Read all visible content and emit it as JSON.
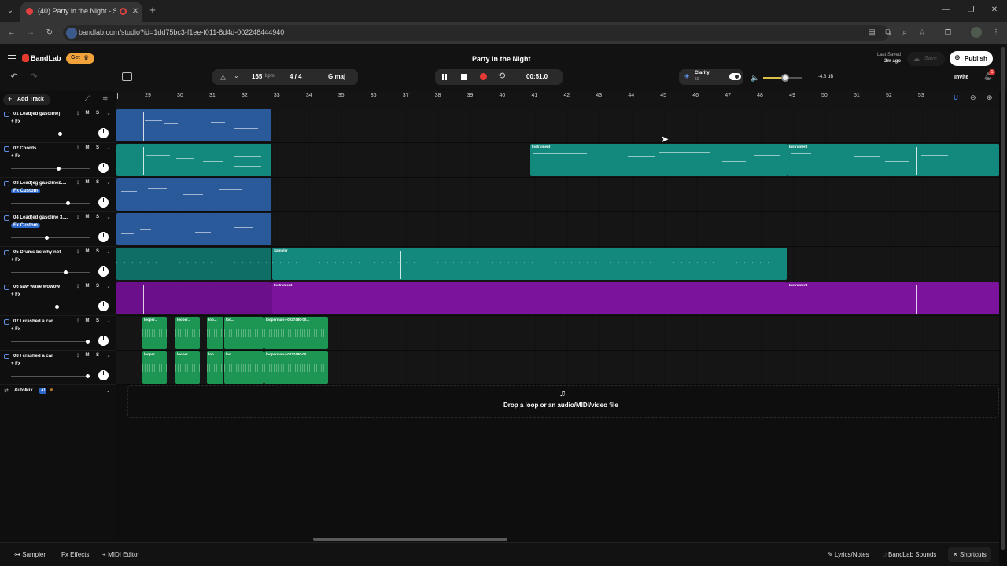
{
  "browser": {
    "tab_title": "(40) Party in the Night - Stu",
    "url": "bandlab.com/studio?id=1dd75bc3-f1ee-f011-8d4d-002248444940"
  },
  "header": {
    "brand": "BandLab",
    "get_label": "Get",
    "project_title": "Party in the Night",
    "last_saved_label": "Last Saved",
    "last_saved_time": "2m ago",
    "save_label": "Save",
    "publish_label": "Publish",
    "invite_label": "Invite",
    "notification_count": "1"
  },
  "transport": {
    "bpm_value": "165",
    "bpm_unit": "bpm",
    "time_signature": "4 / 4",
    "key": "G maj",
    "time": "00:51.0"
  },
  "master": {
    "clarity_label": "Clarity",
    "clarity_value": "50",
    "volume_db": "-4.8 dB",
    "volume_level": 0.55
  },
  "toolbar": {
    "add_track_label": "Add Track"
  },
  "ruler": {
    "bars": [
      "29",
      "30",
      "31",
      "32",
      "33",
      "34",
      "35",
      "36",
      "37",
      "38",
      "39",
      "40",
      "41",
      "42",
      "43",
      "44",
      "45",
      "46",
      "47",
      "48",
      "49",
      "50",
      "51",
      "52",
      "53"
    ]
  },
  "tracks": [
    {
      "name": "01  Lead(ed gasoline)",
      "fx": "+ Fx",
      "fx_custom": false,
      "volume": 0.62
    },
    {
      "name": "02  Chords",
      "fx": "+ Fx",
      "fx_custom": false,
      "volume": 0.6
    },
    {
      "name": "03  Lead(eg gasoline2....",
      "fx": "Fx Custom",
      "fx_custom": true,
      "volume": 0.72
    },
    {
      "name": "04  Lead(ed gasoline 3....",
      "fx": "Fx Custom",
      "fx_custom": true,
      "volume": 0.45
    },
    {
      "name": "05  Drums bc why not",
      "fx": "+ Fx",
      "fx_custom": false,
      "volume": 0.69
    },
    {
      "name": "06  saw wave wowow",
      "fx": "+ Fx",
      "fx_custom": false,
      "volume": 0.58
    },
    {
      "name": "07  I crashed a car",
      "fx": "+ Fx",
      "fx_custom": false,
      "volume": 0.97
    },
    {
      "name": "08  I crashed a car",
      "fx": "+ Fx",
      "fx_custom": false,
      "volume": 0.97
    }
  ],
  "track_buttons": {
    "mute": "M",
    "solo": "S"
  },
  "clips": {
    "chords_a": "Instrument",
    "chords_b": "Instrument",
    "drums": "Sampler",
    "saw_a": "Instrument",
    "saw_b": "Instrument",
    "looper_1": "looper...",
    "looper_2": "looper...",
    "looper_3": "loo...",
    "looper_4": "loo...",
    "looper_5": "looperman-l-0227480-00...",
    "looper_6": "looper...",
    "looper_7": "looper...",
    "looper_8": "loo...",
    "looper_9": "loo...",
    "looper_10": "looperman-l-0227480-00..."
  },
  "automix": {
    "label": "AutoMix",
    "badge": "AI"
  },
  "drop_zone": {
    "text": "Drop a loop or an audio/MIDI/video file"
  },
  "bottom": {
    "sampler": "Sampler",
    "effects": "Effects",
    "midi_editor": "MIDI Editor",
    "lyrics": "Lyrics/Notes",
    "sounds": "BandLab Sounds",
    "shortcuts": "Shortcuts"
  },
  "colors": {
    "lead_blue": "#2b5a9a",
    "teal": "#12897c",
    "purple": "#7b139d",
    "green": "#1c9652",
    "record_red": "#e53935",
    "accent_blue": "#2a67c9"
  }
}
